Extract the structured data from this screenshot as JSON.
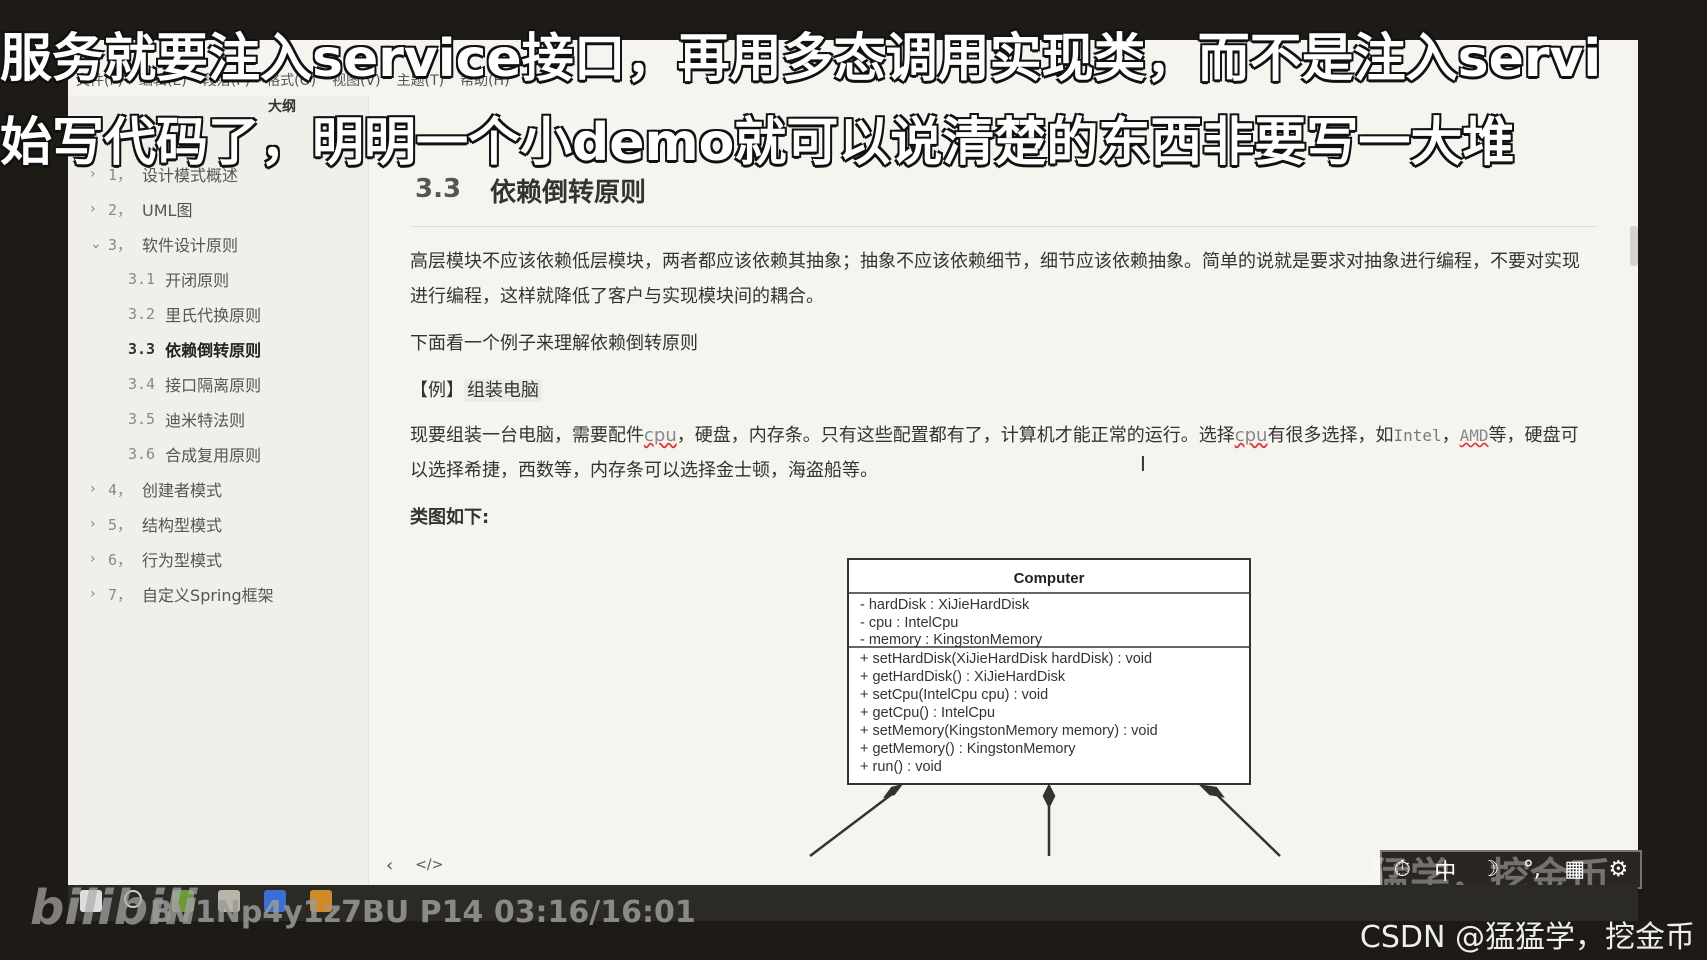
{
  "subtitles": {
    "line1": "服务就要注入service接口，再用多态调用实现类，而不是注入servi",
    "line2": "始写代码了，明明一个小demo就可以说清楚的东西非要写一大堆"
  },
  "menu": [
    "文件(F)",
    "编辑(E)",
    "段落(P)",
    "格式(O)",
    "视图(V)",
    "主题(T)",
    "帮助(H)"
  ],
  "sidebar": {
    "title": "大纲",
    "items": [
      {
        "num": "1，",
        "label": "设计模式概述",
        "chev": "›"
      },
      {
        "num": "2，",
        "label": "UML图",
        "chev": "›"
      },
      {
        "num": "3，",
        "label": "软件设计原则",
        "chev": "⌄"
      },
      {
        "num": "3.1",
        "label": "开闭原则",
        "chev": ""
      },
      {
        "num": "3.2",
        "label": "里氏代换原则",
        "chev": ""
      },
      {
        "num": "3.3",
        "label": "依赖倒转原则",
        "chev": ""
      },
      {
        "num": "3.4",
        "label": "接口隔离原则",
        "chev": ""
      },
      {
        "num": "3.5",
        "label": "迪米特法则",
        "chev": ""
      },
      {
        "num": "3.6",
        "label": "合成复用原则",
        "chev": ""
      },
      {
        "num": "4，",
        "label": "创建者模式",
        "chev": "›"
      },
      {
        "num": "5，",
        "label": "结构型模式",
        "chev": "›"
      },
      {
        "num": "6，",
        "label": "行为型模式",
        "chev": "›"
      },
      {
        "num": "7，",
        "label": "自定义Spring框架",
        "chev": "›"
      }
    ]
  },
  "document": {
    "heading_num": "3.3",
    "heading": "依赖倒转原则",
    "para1": "高层模块不应该依赖低层模块，两者都应该依赖其抽象；抽象不应该依赖细节，细节应该依赖抽象。简单的说就是要求对抽象进行编程，不要对实现进行编程，这样就降低了客户与实现模块间的耦合。",
    "para2": "下面看一个例子来理解依赖倒转原则",
    "example_prefix": "【例】",
    "example_title": "组装电脑",
    "para4": {
      "t1": "现要组装一台电脑，需要配件",
      "cpu": "cpu",
      "t2": "，硬盘，内存条。只有这些配置都有了，计算机才能正常的运行。选择",
      "cpu2": "cpu",
      "t3": "有很多选择，如",
      "intel": "Intel",
      "t4": "，",
      "amd": "AMD",
      "t5": "等，硬盘可以选择希捷，西数等，内存条可以选择金士顿，海盗船等。"
    },
    "class_diagram_label": "类图如下:"
  },
  "uml": {
    "class_name": "Computer",
    "attributes": [
      "- hardDisk : XiJieHardDisk",
      "- cpu : IntelCpu",
      "- memory : KingstonMemory"
    ],
    "methods": [
      "+ setHardDisk(XiJieHardDisk hardDisk) : void",
      "+ getHardDisk() : XiJieHardDisk",
      "+ setCpu(IntelCpu cpu) : void",
      "+ getCpu() : IntelCpu",
      "+ setMemory(KingstonMemory memory) : void",
      "+ getMemory() : KingstonMemory",
      "+ run() : void"
    ]
  },
  "bottom_bar": {
    "back": "‹",
    "source": "</>"
  },
  "tray": [
    "⏱",
    "中",
    "☽",
    "°,",
    "▦",
    "⚙"
  ],
  "video_id": "BV1Np4y1z7BU P14 03:16/16:01",
  "watermark": "CSDN @猛猛学，挖金币",
  "bili_logo": "bilibili",
  "blur_text": "…猛学，挖金币"
}
